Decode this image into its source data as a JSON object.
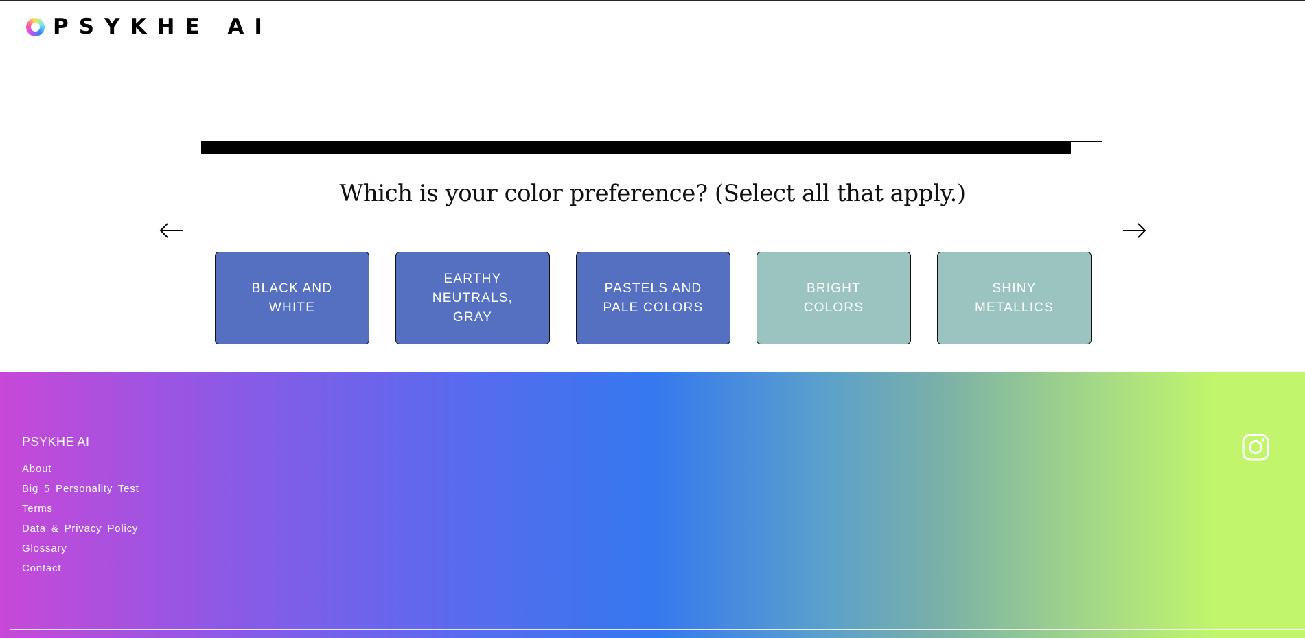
{
  "header": {
    "logo_text": "PSYKHE AI"
  },
  "progress": {
    "fraction": 0.966
  },
  "question": {
    "text": "Which is your color preference? (Select all that apply.)"
  },
  "nav": {
    "prev_icon": "arrow-left-icon",
    "next_icon": "arrow-right-icon"
  },
  "options": [
    {
      "label": "BLACK AND WHITE",
      "selected": true
    },
    {
      "label": "EARTHY NEUTRALS, GRAY",
      "selected": true
    },
    {
      "label": "PASTELS AND PALE COLORS",
      "selected": true
    },
    {
      "label": "BRIGHT COLORS",
      "selected": false
    },
    {
      "label": "SHINY METALLICS",
      "selected": false
    }
  ],
  "colors": {
    "selected_option": "#5570c0",
    "unselected_option": "#9bc4c1",
    "progress_fill": "#000000"
  },
  "footer": {
    "title": "PSYKHE AI",
    "links": [
      "About",
      "Big 5 Personality Test",
      "Terms",
      "Data & Privacy Policy",
      "Glossary",
      "Contact"
    ],
    "social_icon": "instagram-icon"
  }
}
